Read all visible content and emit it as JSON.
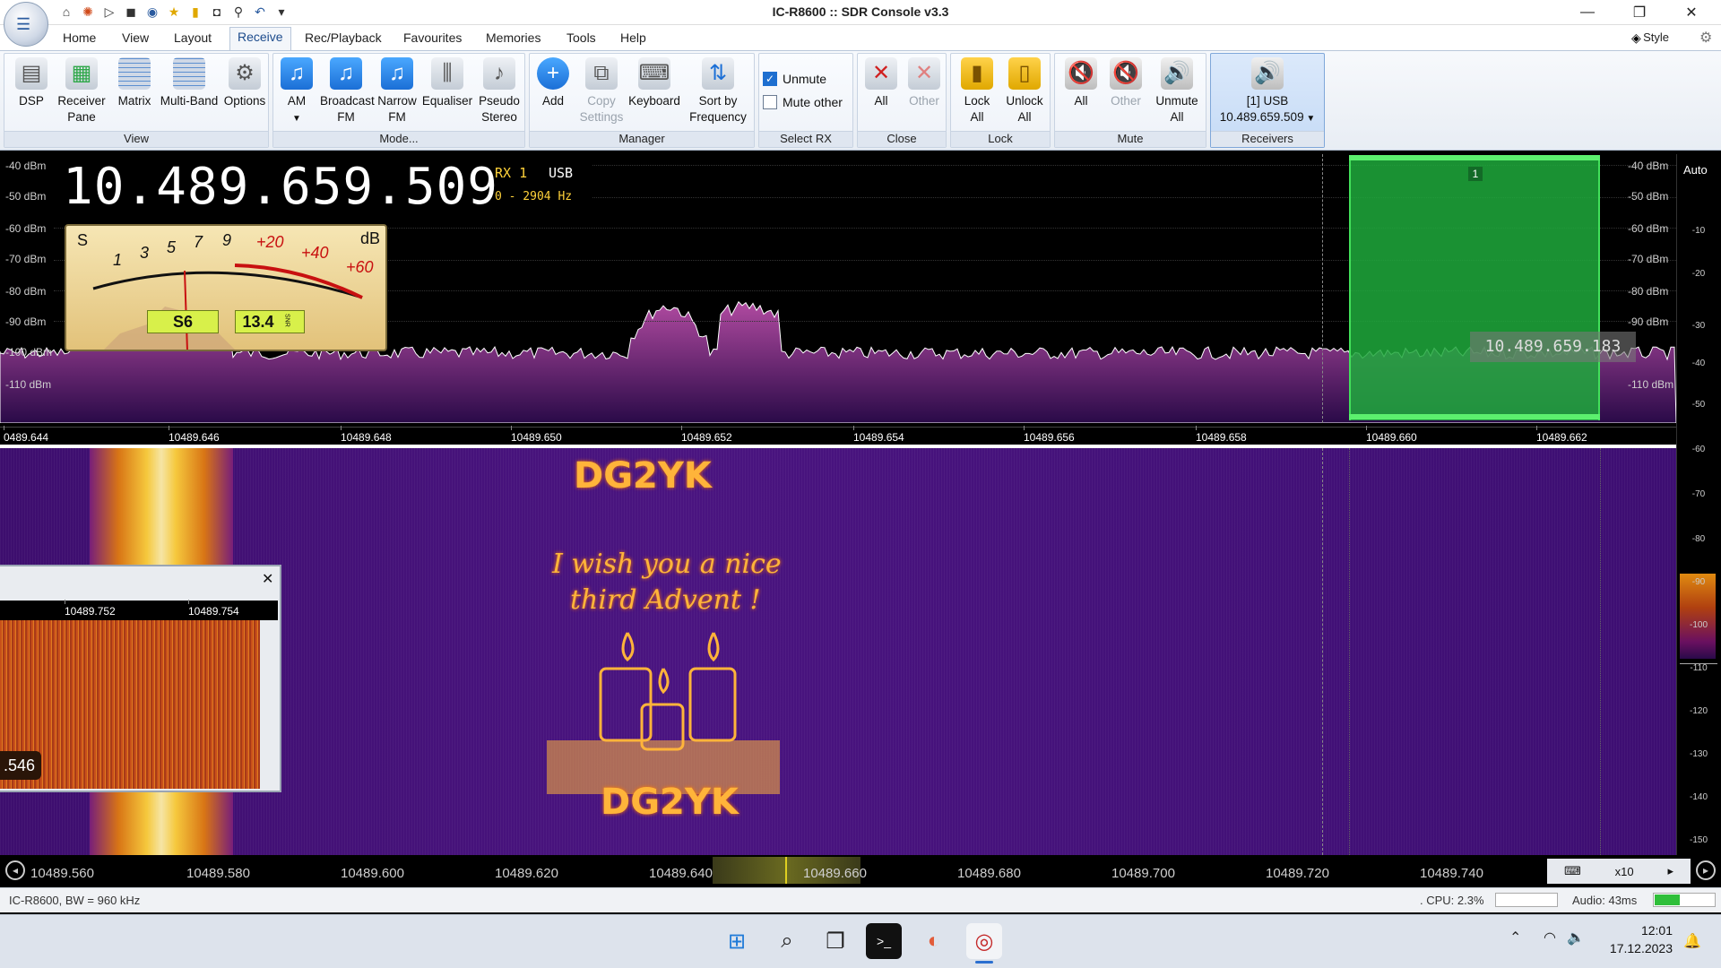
{
  "window": {
    "title": "IC-R8600 :: SDR Console v3.3",
    "minimize": "—",
    "restore": "❐",
    "close": "✕"
  },
  "tabs": [
    "Home",
    "View",
    "Layout",
    "Receive",
    "Rec/Playback",
    "Favourites",
    "Memories",
    "Tools",
    "Help"
  ],
  "active_tab": "Receive",
  "style_label": "Style",
  "ribbon": {
    "view_group": {
      "label": "View",
      "buttons": [
        "DSP",
        "Receiver Pane",
        "Matrix",
        "Multi-Band",
        "Options"
      ]
    },
    "mode_group": {
      "label": "Mode...",
      "buttons": [
        "AM",
        "Broadcast FM",
        "Narrow FM",
        "Equaliser",
        "Pseudo Stereo"
      ]
    },
    "manager_group": {
      "label": "Manager",
      "buttons": [
        "Add",
        "Copy Settings",
        "Keyboard",
        "Sort by Frequency"
      ]
    },
    "selectrx_group": {
      "label": "Select RX",
      "unmute": "Unmute",
      "mute_other": "Mute other"
    },
    "close_group": {
      "label": "Close",
      "buttons": [
        "All",
        "Other"
      ]
    },
    "lock_group": {
      "label": "Lock",
      "buttons": [
        "Lock All",
        "Unlock All"
      ]
    },
    "mute_group": {
      "label": "Mute",
      "buttons": [
        "All",
        "Other",
        "Unmute All"
      ]
    },
    "receivers_group": {
      "label": "Receivers",
      "line1": "[1]  USB",
      "line2": "10.489.659.509"
    }
  },
  "receiver": {
    "frequency": "10.489.659.509",
    "rx": "RX 1",
    "mode": "USB",
    "bandwidth": "0 - 2904 Hz",
    "s_reading": "S6",
    "snr_reading": "13.4",
    "snr_unit": "SNR"
  },
  "smeter": {
    "s_label": "S",
    "db_label": "dB",
    "scale": [
      "1",
      "3",
      "5",
      "7",
      "9"
    ],
    "plus_scale": [
      "+20",
      "+40",
      "+60"
    ]
  },
  "spectrum": {
    "db_labels_left": [
      "-40 dBm",
      "-50 dBm",
      "-60 dBm",
      "-70 dBm",
      "-80 dBm",
      "-90 dBm",
      "-100 dBm",
      "-110 dBm"
    ],
    "db_labels_right": [
      "-40 dBm",
      "-50 dBm",
      "-60 dBm",
      "-70 dBm",
      "-80 dBm",
      "-90 dBm",
      "-110 dBm"
    ],
    "cursor_freq": "10.489.659.183",
    "rx_tag": "1",
    "axis": [
      "0489.644",
      "10489.646",
      "10489.648",
      "10489.650",
      "10489.652",
      "10489.654",
      "10489.656",
      "10489.658",
      "10489.660",
      "10489.662"
    ]
  },
  "waterfall": {
    "callsign_top": "DG2YK",
    "greeting_line1": "I wish you a nice",
    "greeting_line2": "third Advent !",
    "callsign_bottom": "DG2YK"
  },
  "colorscale": {
    "auto": "Auto",
    "labels": [
      "-10",
      "-20",
      "-30",
      "-40",
      "-50",
      "-60",
      "-70",
      "-80",
      "-90",
      "-100",
      "-110",
      "-120",
      "-130",
      "-140",
      "-150"
    ]
  },
  "mini_window": {
    "close": "✕",
    "axis": [
      "10489.752",
      "10489.754"
    ],
    "value": ".546"
  },
  "bottom_axis": [
    "10489.560",
    "10489.580",
    "10489.600",
    "10489.620",
    "10489.640",
    "10489.660",
    "10489.680",
    "10489.700",
    "10489.720",
    "10489.740"
  ],
  "zoom": "x10",
  "status": {
    "left": "IC-R8600, BW = 960 kHz",
    "cpu": ". CPU: 2.3%",
    "audio": "Audio: 43ms"
  },
  "tray": {
    "time": "12:01",
    "date": "17.12.2023"
  }
}
